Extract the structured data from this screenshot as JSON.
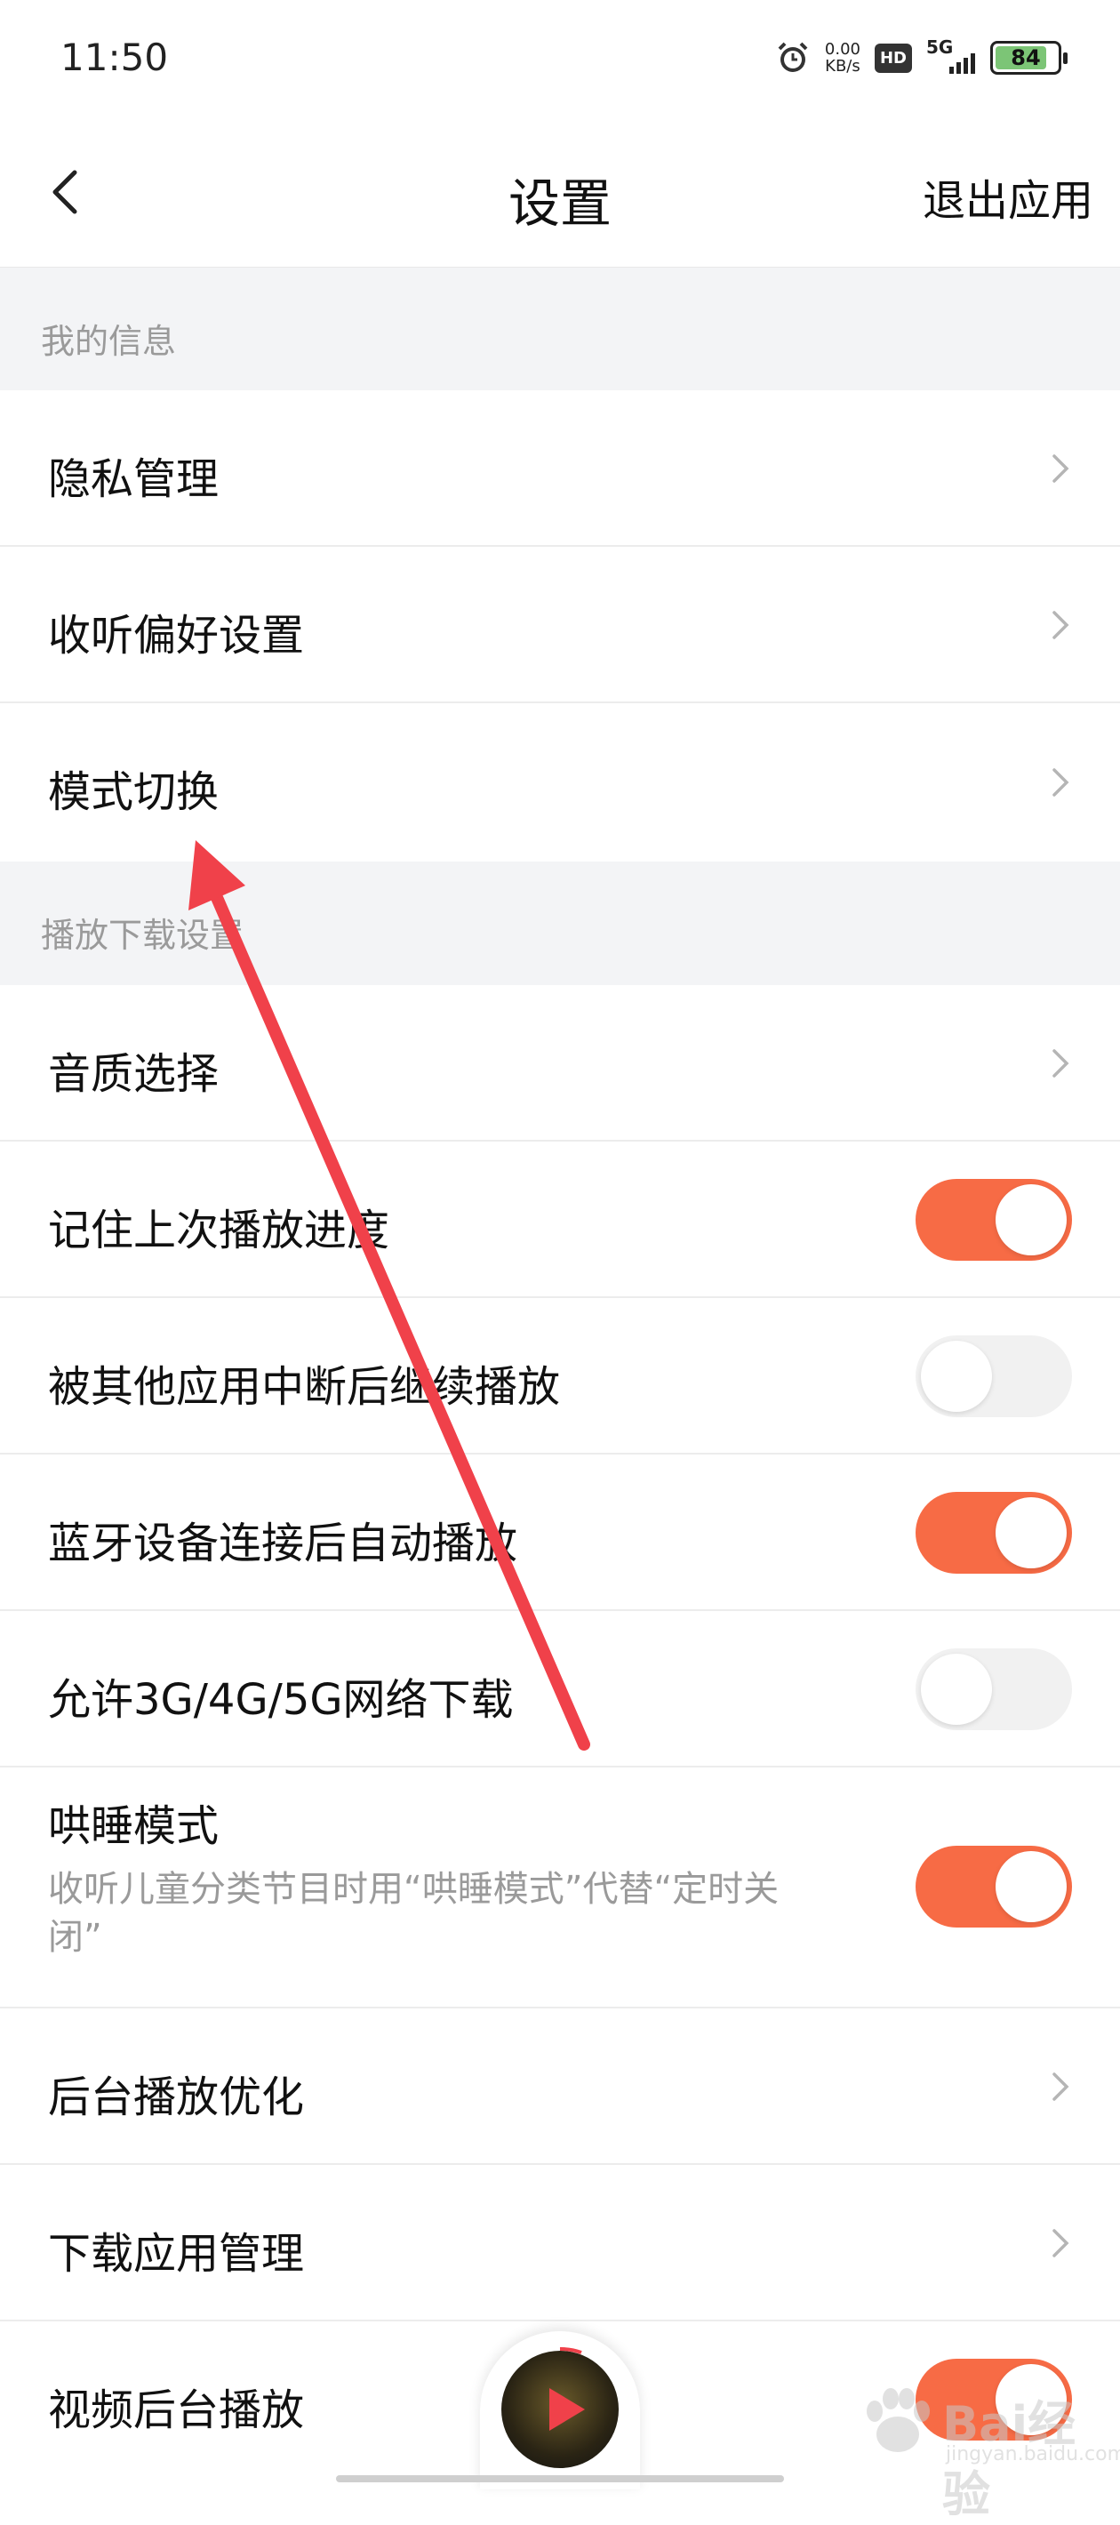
{
  "status_bar": {
    "time": "11:50",
    "net_speed_value": "0.00",
    "net_speed_unit": "KB/s",
    "hd_badge": "HD",
    "network": "5G",
    "battery": "84",
    "battery_level": 0.84
  },
  "header": {
    "title": "设置",
    "exit_label": "退出应用"
  },
  "sections": [
    {
      "label": "我的信息"
    },
    {
      "label": "播放下载设置"
    }
  ],
  "rows": {
    "privacy": {
      "label": "隐私管理"
    },
    "listening_pref": {
      "label": "收听偏好设置"
    },
    "mode_switch": {
      "label": "模式切换"
    },
    "sound_quality": {
      "label": "音质选择"
    },
    "remember_progress": {
      "label": "记住上次播放进度",
      "enabled": true
    },
    "resume_after_interrupt": {
      "label": "被其他应用中断后继续播放",
      "enabled": false
    },
    "bluetooth_autoplay": {
      "label": "蓝牙设备连接后自动播放",
      "enabled": true
    },
    "mobile_download": {
      "label": "允许3G/4G/5G网络下载",
      "enabled": false
    },
    "sleep_mode": {
      "label": "哄睡模式",
      "desc": "收听儿童分类节目时用“哄睡模式”代替“定时关闭”",
      "enabled": true
    },
    "background_optimize": {
      "label": "后台播放优化"
    },
    "download_app_manage": {
      "label": "下载应用管理"
    },
    "video_background": {
      "label": "视频后台播放",
      "enabled": true
    }
  },
  "colors": {
    "accent": "#f76b45",
    "toggle_off": "#f1f1f1",
    "section_bg": "#f3f4f6",
    "secondary_text": "#9a9a9a",
    "annotation_arrow": "#f0414a"
  },
  "watermark": {
    "brand": "Bai经验",
    "url": "jingyan.baidu.com"
  }
}
